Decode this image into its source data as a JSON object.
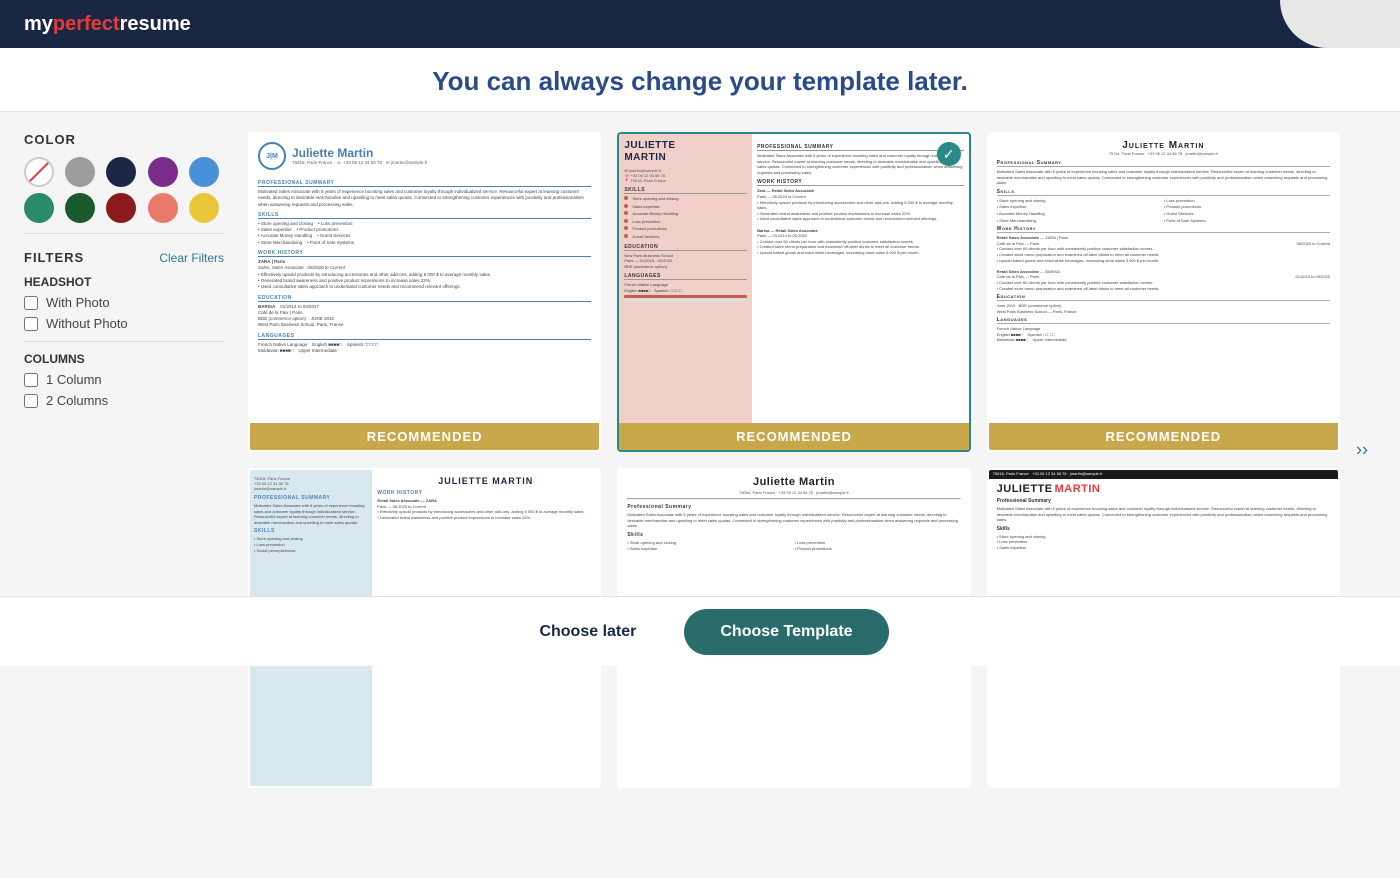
{
  "header": {
    "logo_my": "my",
    "logo_perfect": "perfect",
    "logo_resume": "resume"
  },
  "subtitle": {
    "text": "You can always change your template later."
  },
  "sidebar": {
    "color_section_title": "COLOR",
    "filters_title": "FILTERS",
    "clear_filters_label": "Clear Filters",
    "headshot_title": "HEADSHOT",
    "with_photo_label": "With Photo",
    "without_photo_label": "Without Photo",
    "columns_title": "COLUMNS",
    "one_column_label": "1 Column",
    "two_columns_label": "2 Columns",
    "colors": [
      {
        "id": "none",
        "bg": "white",
        "strikethrough": true
      },
      {
        "id": "gray",
        "bg": "#9e9e9e",
        "strikethrough": false
      },
      {
        "id": "navy",
        "bg": "#1a2744",
        "strikethrough": false
      },
      {
        "id": "purple",
        "bg": "#7b2d8b",
        "strikethrough": false
      },
      {
        "id": "blue",
        "bg": "#4a90d9",
        "strikethrough": false
      },
      {
        "id": "teal",
        "bg": "#2a8a6a",
        "strikethrough": false
      },
      {
        "id": "dark-green",
        "bg": "#1a5a2a",
        "strikethrough": false
      },
      {
        "id": "dark-red",
        "bg": "#8b1a1a",
        "strikethrough": false
      },
      {
        "id": "salmon",
        "bg": "#e87a6a",
        "strikethrough": false
      },
      {
        "id": "yellow",
        "bg": "#e8c83a",
        "strikethrough": false
      }
    ]
  },
  "templates": [
    {
      "id": "tmpl1",
      "selected": false,
      "recommended": true,
      "style": "blue-accent"
    },
    {
      "id": "tmpl2",
      "selected": true,
      "recommended": true,
      "style": "pink-sidebar"
    },
    {
      "id": "tmpl3",
      "selected": false,
      "recommended": true,
      "style": "classic"
    },
    {
      "id": "tmpl4",
      "selected": false,
      "recommended": false,
      "style": "light-blue-sidebar"
    },
    {
      "id": "tmpl5",
      "selected": false,
      "recommended": false,
      "style": "classic-divider"
    },
    {
      "id": "tmpl6",
      "selected": false,
      "recommended": false,
      "style": "red-accent"
    }
  ],
  "footer": {
    "choose_later_label": "Choose later",
    "choose_template_label": "Choose Template"
  }
}
